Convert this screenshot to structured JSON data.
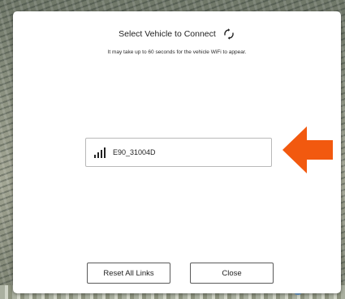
{
  "dialog": {
    "title": "Select Vehicle to Connect",
    "refresh_icon": "refresh-icon",
    "subtitle": "It may take up to 60 seconds for the vehicle WiFi to appear.",
    "networks": [
      {
        "name": "E90_31004D",
        "icon": "wifi-signal-icon"
      }
    ],
    "buttons": {
      "reset_label": "Reset All Links",
      "close_label": "Close"
    }
  },
  "annotation": {
    "arrow_icon": "arrow-left-icon",
    "arrow_color": "#f2590f"
  }
}
